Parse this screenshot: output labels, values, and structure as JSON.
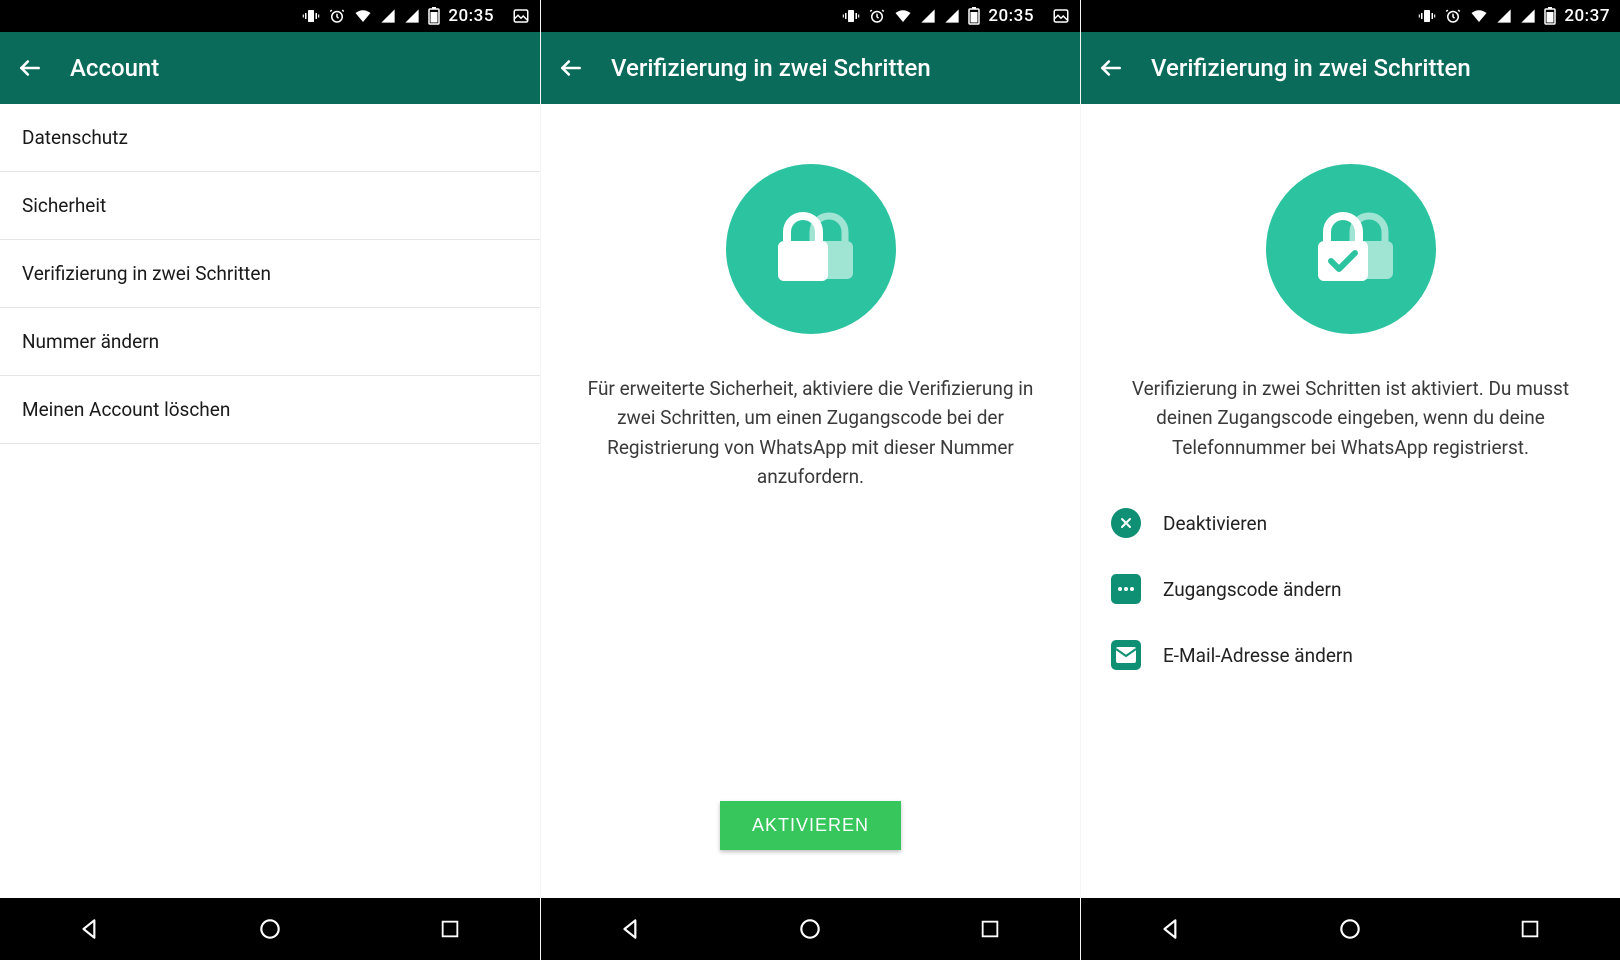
{
  "statusbar": {
    "times": [
      "20:35",
      "20:35",
      "20:37"
    ]
  },
  "screens": [
    {
      "title": "Account",
      "list": [
        "Datenschutz",
        "Sicherheit",
        "Verifizierung in zwei Schritten",
        "Nummer ändern",
        "Meinen Account löschen"
      ]
    },
    {
      "title": "Verifizierung in zwei Schritten",
      "description": "Für erweiterte Sicherheit, aktiviere die Verifizierung in zwei Schritten, um einen Zugangscode bei der Registrierung von WhatsApp mit dieser Nummer anzufordern.",
      "activate_label": "AKTIVIEREN"
    },
    {
      "title": "Verifizierung in zwei Schritten",
      "description": "Verifizierung in zwei Schritten ist aktiviert. Du musst deinen Zugangscode eingeben, wenn du deine Telefonnummer bei WhatsApp registrierst.",
      "options": [
        {
          "label": "Deaktivieren"
        },
        {
          "label": "Zugangscode ändern"
        },
        {
          "label": "E-Mail-Adresse ändern"
        }
      ]
    }
  ]
}
